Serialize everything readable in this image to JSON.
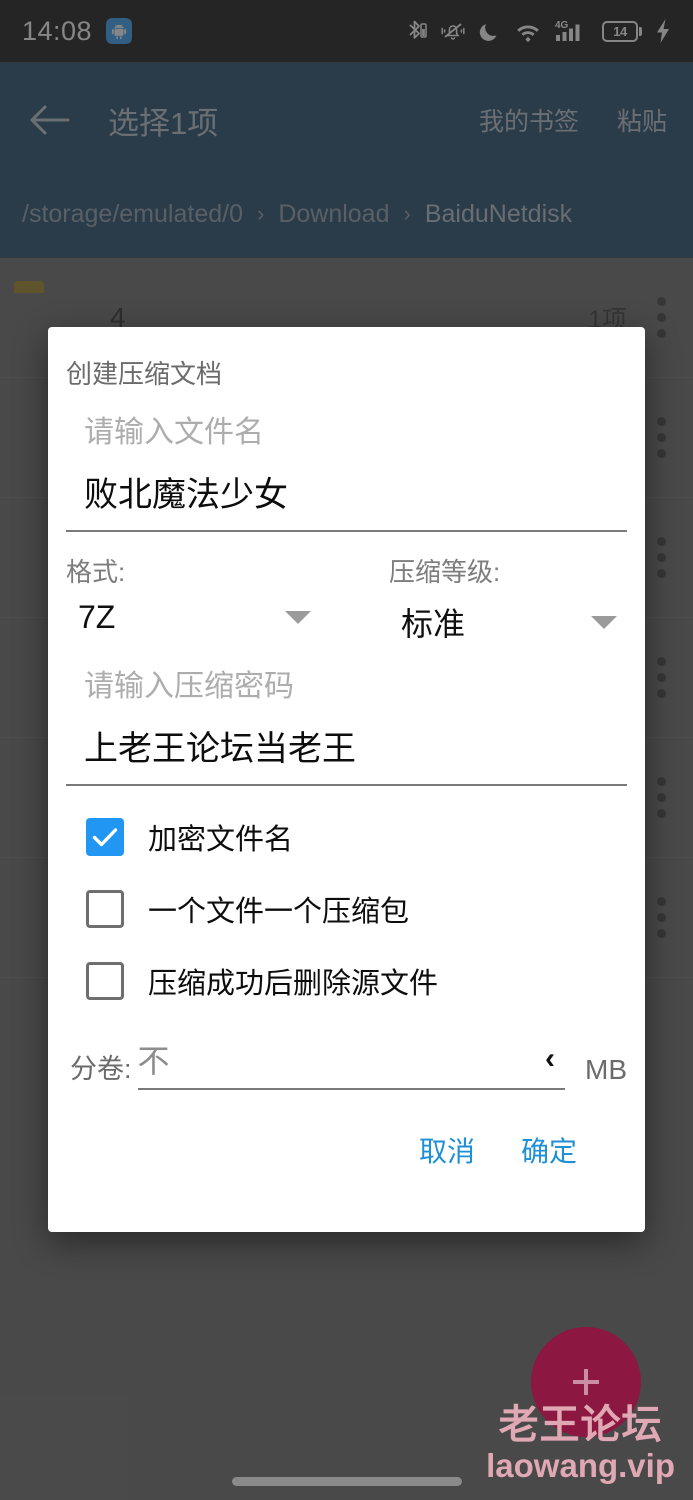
{
  "status_bar": {
    "time": "14:08",
    "app_icon": "android-robot-icon",
    "icons": [
      "bluetooth-icon",
      "vibrate-icon",
      "do-not-disturb-moon-icon",
      "wifi-icon",
      "signal-4g-icon",
      "battery-icon",
      "charging-bolt-icon"
    ],
    "battery_level": "14",
    "network_type": "4G"
  },
  "app_bar": {
    "back_icon": "back-arrow-icon",
    "title": "选择1项",
    "action_bookmarks": "我的书签",
    "action_paste": "粘贴",
    "background_color": "#0f3d63",
    "breadcrumb": [
      "/storage/emulated/0",
      "Download",
      "BaiduNetdisk"
    ],
    "breadcrumb_separator": "›"
  },
  "file_list": [
    {
      "icon": "folder-icon",
      "icon_color": "#9a7d11",
      "name": "4",
      "meta": "1项"
    },
    {
      "icon": "file-icon",
      "icon_color": "#3f7a3f",
      "name": "",
      "meta": ""
    },
    {
      "icon": "file-icon",
      "icon_color": "#9e3b18",
      "name": "",
      "meta": ""
    },
    {
      "icon": "file-icon",
      "icon_color": "#9e3b18",
      "name": "",
      "meta": ""
    },
    {
      "icon": "file-icon",
      "icon_color": "#9a8b11",
      "name": "",
      "meta": ""
    },
    {
      "icon": "file-icon",
      "icon_color": "#9e3b18",
      "name": "",
      "meta": ""
    }
  ],
  "dialog": {
    "title": "创建压缩文档",
    "filename": {
      "placeholder": "请输入文件名",
      "value": "败北魔法少女"
    },
    "format": {
      "label": "格式:",
      "value": "7Z"
    },
    "level": {
      "label": "压缩等级:",
      "value": "标准"
    },
    "password": {
      "placeholder": "请输入压缩密码",
      "value": "上老王论坛当老王"
    },
    "checkboxes": [
      {
        "label": "加密文件名",
        "checked": true
      },
      {
        "label": "一个文件一个压缩包",
        "checked": false
      },
      {
        "label": "压缩成功后删除源文件",
        "checked": false
      }
    ],
    "split": {
      "label": "分卷:",
      "value": "不",
      "unit": "MB",
      "stepper_icon": "chevron-left-icon"
    },
    "cancel_label": "取消",
    "confirm_label": "确定",
    "accent_color": "#1f8fd6"
  },
  "fab": {
    "icon": "plus-icon",
    "color": "#8c1741"
  },
  "watermark": {
    "line1": "老王论坛",
    "line2": "laowang.vip",
    "color": "#e0a8b4"
  }
}
